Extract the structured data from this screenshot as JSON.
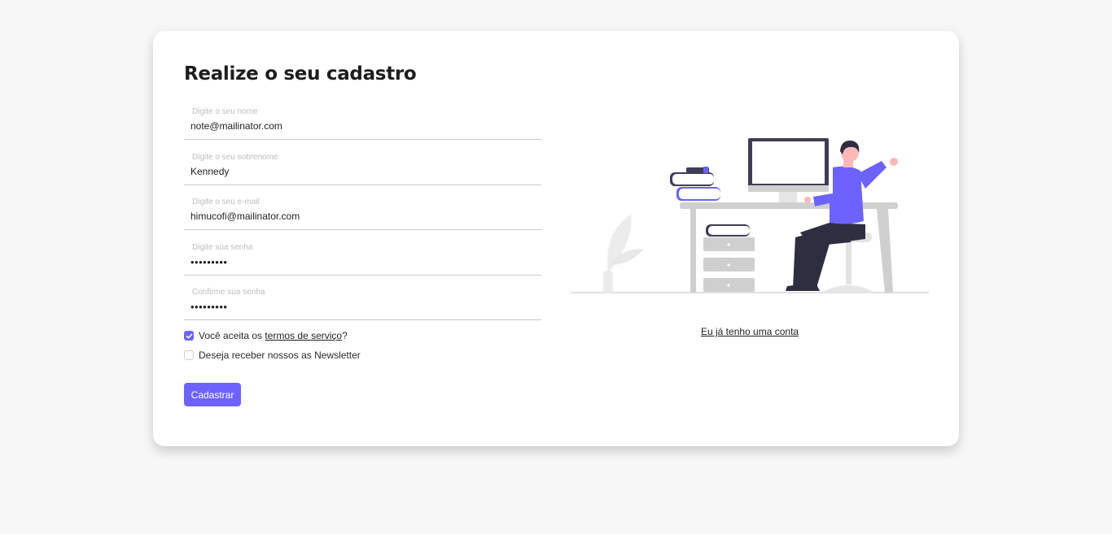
{
  "form": {
    "title": "Realize o seu cadastro",
    "fields": [
      {
        "label": "Digite o seu nome",
        "value": "note@mailinator.com",
        "type": "text"
      },
      {
        "label": "Digite o seu sobrenome",
        "value": "Kennedy",
        "type": "text"
      },
      {
        "label": "Digite o seu e-mail",
        "value": "himucofi@mailinator.com",
        "type": "email"
      },
      {
        "label": "Digite sua senha",
        "value": "•••••••••",
        "type": "password"
      },
      {
        "label": "Confirme sua senha",
        "value": "•••••••••",
        "type": "password"
      }
    ],
    "terms": {
      "prefix": "Você aceita os ",
      "link": "termos de serviço",
      "suffix": "?",
      "checked": true
    },
    "newsletter": {
      "label": "Deseja receber nossos as Newsletter",
      "checked": false
    },
    "submit_label": "Cadastrar"
  },
  "side": {
    "login_link": "Eu já tenho uma conta",
    "illustration": "person-working-at-desk"
  },
  "colors": {
    "accent": "#6c63ff",
    "background": "#f7f7f7",
    "card": "#ffffff"
  }
}
